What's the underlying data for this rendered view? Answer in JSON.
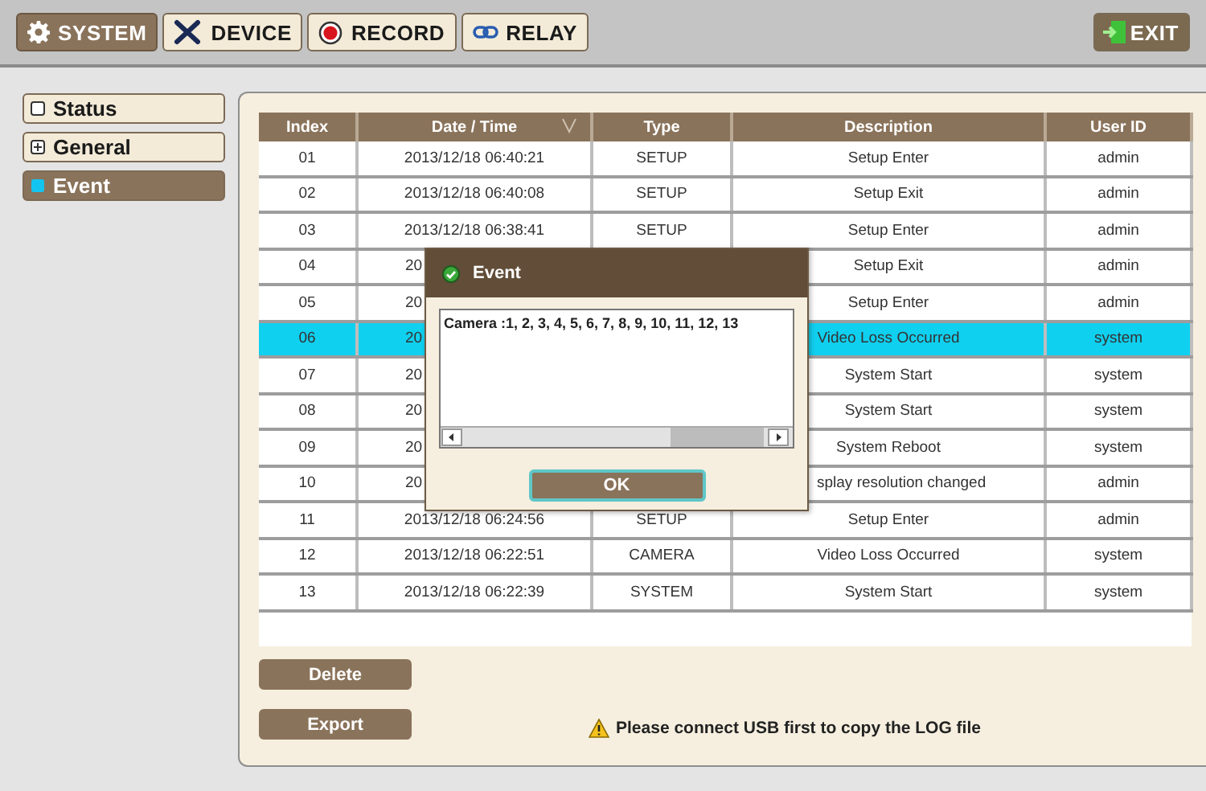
{
  "toolbar": {
    "tabs": [
      {
        "label": "SYSTEM",
        "selected": true
      },
      {
        "label": "DEVICE",
        "selected": false
      },
      {
        "label": "RECORD",
        "selected": false
      },
      {
        "label": "RELAY",
        "selected": false
      }
    ],
    "exit": "EXIT"
  },
  "sidebar": {
    "items": [
      {
        "label": "Status",
        "kind": "page",
        "selected": false
      },
      {
        "label": "General",
        "kind": "group",
        "selected": false
      },
      {
        "label": "Event",
        "kind": "page",
        "selected": true
      }
    ]
  },
  "table": {
    "columns": [
      "Index",
      "Date / Time",
      "Type",
      "Description",
      "User ID"
    ],
    "rows": [
      {
        "index": "01",
        "date": "2013/12/18 06:40:21",
        "type": "SETUP",
        "description": "Setup Enter",
        "user_id": "admin",
        "selected": false
      },
      {
        "index": "02",
        "date": "2013/12/18 06:40:08",
        "type": "SETUP",
        "description": "Setup Exit",
        "user_id": "admin",
        "selected": false
      },
      {
        "index": "03",
        "date": "2013/12/18 06:38:41",
        "type": "SETUP",
        "description": "Setup Enter",
        "user_id": "admin",
        "selected": false
      },
      {
        "index": "04",
        "date": "20",
        "covered": true,
        "description": "Setup Exit",
        "user_id": "admin",
        "selected": false
      },
      {
        "index": "05",
        "date": "20",
        "covered": true,
        "description": "Setup Enter",
        "user_id": "admin",
        "selected": false
      },
      {
        "index": "06",
        "date": "20",
        "covered": true,
        "description": "Video Loss Occurred",
        "user_id": "system",
        "selected": true
      },
      {
        "index": "07",
        "date": "20",
        "covered": true,
        "description": "System Start",
        "user_id": "system",
        "selected": false
      },
      {
        "index": "08",
        "date": "20",
        "covered": true,
        "description": "System Start",
        "user_id": "system",
        "selected": false
      },
      {
        "index": "09",
        "date": "20",
        "covered": true,
        "description": "System Reboot",
        "user_id": "system",
        "selected": false
      },
      {
        "index": "10",
        "date": "20",
        "covered": true,
        "description": "splay resolution changed",
        "description_cut": true,
        "user_id": "admin",
        "selected": false
      },
      {
        "index": "11",
        "date": "2013/12/18 06:24:56",
        "type": "SETUP",
        "description": "Setup Enter",
        "user_id": "admin",
        "selected": false
      },
      {
        "index": "12",
        "date": "2013/12/18 06:22:51",
        "type": "CAMERA",
        "description": "Video Loss Occurred",
        "user_id": "system",
        "selected": false
      },
      {
        "index": "13",
        "date": "2013/12/18 06:22:39",
        "type": "SYSTEM",
        "description": "System Start",
        "user_id": "system",
        "selected": false
      }
    ]
  },
  "dialog": {
    "title": "Event",
    "text": "Camera :1, 2, 3, 4, 5, 6, 7, 8, 9, 10, 11, 12, 13",
    "button": "OK"
  },
  "actions": {
    "buttons": [
      "Delete",
      "Export"
    ],
    "warning": "Please connect USB first to copy the LOG file"
  }
}
